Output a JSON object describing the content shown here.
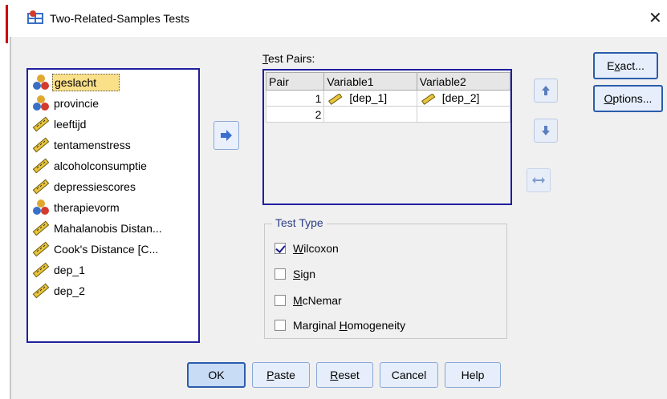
{
  "window": {
    "title": "Two-Related-Samples Tests",
    "close_icon": "close-icon"
  },
  "variables": [
    {
      "label": "geslacht",
      "icon": "nominal-icon",
      "selected": true
    },
    {
      "label": "provincie",
      "icon": "nominal-icon"
    },
    {
      "label": "leeftijd",
      "icon": "scale-icon"
    },
    {
      "label": "tentamenstress",
      "icon": "scale-icon"
    },
    {
      "label": "alcoholconsumptie",
      "icon": "scale-icon"
    },
    {
      "label": "depressiescores",
      "icon": "scale-icon"
    },
    {
      "label": "therapievorm",
      "icon": "nominal-icon"
    },
    {
      "label": "Mahalanobis Distan...",
      "icon": "scale-icon"
    },
    {
      "label": "Cook's Distance [C...",
      "icon": "scale-icon"
    },
    {
      "label": "dep_1",
      "icon": "scale-icon"
    },
    {
      "label": "dep_2",
      "icon": "scale-icon"
    }
  ],
  "test_pairs": {
    "label_prefix": "T",
    "label_rest": "est Pairs:",
    "columns": [
      "Pair",
      "Variable1",
      "Variable2"
    ],
    "rows": [
      {
        "pair": "1",
        "var1": "[dep_1]",
        "var2": "[dep_2]"
      },
      {
        "pair": "2",
        "var1": "",
        "var2": ""
      }
    ]
  },
  "buttons": {
    "exact_pre": "E",
    "exact_u": "x",
    "exact_post": "act...",
    "options_u": "O",
    "options_post": "ptions...",
    "ok": "OK",
    "paste_u": "P",
    "paste_post": "aste",
    "reset_u": "R",
    "reset_post": "eset",
    "cancel": "Cancel",
    "help": "Help"
  },
  "test_type": {
    "legend": "Test Type",
    "options": [
      {
        "pre": "",
        "u": "W",
        "post": "ilcoxon",
        "checked": true
      },
      {
        "pre": "",
        "u": "S",
        "post": "ign",
        "checked": false
      },
      {
        "pre": "",
        "u": "M",
        "post": "cNemar",
        "checked": false
      },
      {
        "pre": "Marginal ",
        "u": "H",
        "post": "omogeneity",
        "checked": false
      }
    ]
  },
  "colors": {
    "accent": "#2c5cab",
    "selection": "#fbe08a",
    "list_border": "#1f1fa0"
  }
}
